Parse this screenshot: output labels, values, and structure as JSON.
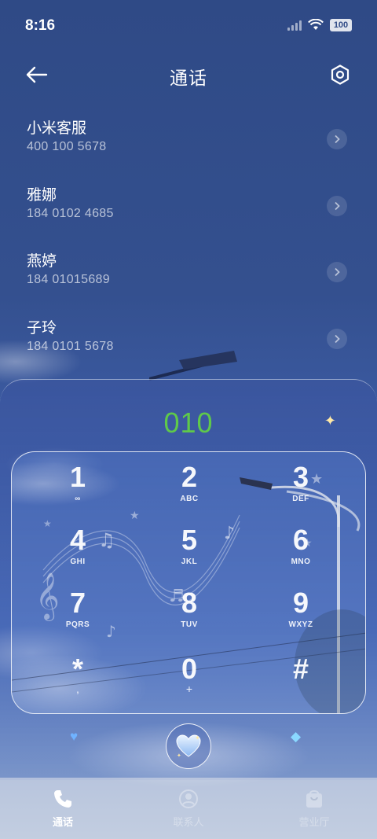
{
  "status_bar": {
    "time": "8:16",
    "battery": "100"
  },
  "header": {
    "title": "通话"
  },
  "recents": [
    {
      "name": "小米客服",
      "number": "400 100 5678"
    },
    {
      "name": "雅娜",
      "number": "184 0102 4685"
    },
    {
      "name": "燕婷",
      "number": "184 01015689"
    },
    {
      "name": "子玲",
      "number": "184 0101 5678"
    }
  ],
  "dialer": {
    "display": "010",
    "display_color": "#5fc94a",
    "keys": [
      {
        "digit": "1",
        "sub": "∞"
      },
      {
        "digit": "2",
        "sub": "ABC"
      },
      {
        "digit": "3",
        "sub": "DEF"
      },
      {
        "digit": "4",
        "sub": "GHI"
      },
      {
        "digit": "5",
        "sub": "JKL"
      },
      {
        "digit": "6",
        "sub": "MNO"
      },
      {
        "digit": "7",
        "sub": "PQRS"
      },
      {
        "digit": "8",
        "sub": "TUV"
      },
      {
        "digit": "9",
        "sub": "WXYZ"
      },
      {
        "digit": "*",
        "sub": ","
      },
      {
        "digit": "0",
        "sub": "+"
      },
      {
        "digit": "#",
        "sub": ""
      }
    ]
  },
  "icons": {
    "back": "arrow-left-icon",
    "settings": "hexagon-gear-icon",
    "detail": "chevron-right-icon",
    "sparkle": "sparkle-star-icon",
    "heart_left": "blue-heart-icon",
    "call": "heart-call-icon",
    "diamond": "diamond-icon"
  },
  "tabs": [
    {
      "label": "通话",
      "icon": "phone-icon",
      "active": true
    },
    {
      "label": "联系人",
      "icon": "contact-person-icon",
      "active": false
    },
    {
      "label": "营业厅",
      "icon": "shopping-bag-icon",
      "active": false
    }
  ]
}
